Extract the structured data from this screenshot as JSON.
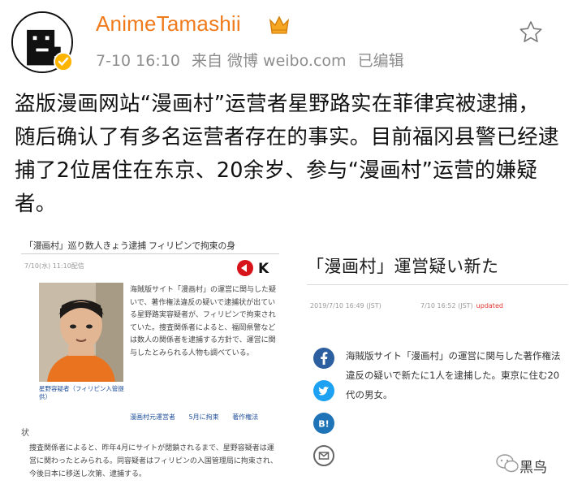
{
  "post": {
    "username": "AnimeTamashii",
    "time": "7-10 16:10",
    "source": "来自 微博 weibo.com",
    "edited": "已编辑",
    "text": "盗版漫画网站“漫画村”运营者星野路实在菲律宾被逮捕，随后确认了有多名运营者存在的事实。目前福冈县警已经逮捕了2位居住在东京、20余岁、参与“漫画村”运营的嫌疑者。"
  },
  "images": {
    "left": {
      "headline": "「漫画村」巡り数人きょう逮捕 フィリピンで拘束の身",
      "date": "7/10(水) 11:10配信",
      "logo_text": "K",
      "caption": "星野容疑者（フィリピン入管提供）",
      "paragraph": "海賊版サイト「漫画村」の運営に関与した疑いで、著作権法違反の疑いで逮捕状が出ている星野路実容疑者が、フィリピンで拘束されていた。捜査関係者によると、福岡県警などは数人の関係者を逮捕する方針で、運営に関与したとみられる人物も調べている。",
      "links": [
        "漫画村元運営者",
        "5月に拘束",
        "著作権法"
      ],
      "kanji": "状",
      "paragraph2": "捜査関係者によると、昨年4月にサイトが閉鎖されるまで、星野容疑者は運営に関わったとみられる。同容疑者はフィリピンの入国管理局に拘束され、今後日本に移送し次第、逮捕する。"
    },
    "right": {
      "title": "「漫画村」運営疑い新た",
      "date1": "2019/7/10 16:49 (JST)",
      "date2": "7/10 16:52 (JST)",
      "updated": "updated",
      "body": "海賊版サイト「漫画村」の運営に関与した著作権法違反の疑いで新たに1人を逮捕した。東京に住む20代の男女。",
      "icons": [
        "facebook-icon",
        "twitter-icon",
        "bookmark-icon",
        "mail-icon"
      ]
    }
  },
  "watermark": "黑鸟",
  "colors": {
    "username": "#f07b1d",
    "meta": "#8d8d8d",
    "verify": "#ffb400",
    "facebook": "#2b5f9f",
    "twitter": "#1da1f2",
    "hatena": "#1f73b7",
    "mail": "#666666",
    "updated": "#e0342b"
  }
}
